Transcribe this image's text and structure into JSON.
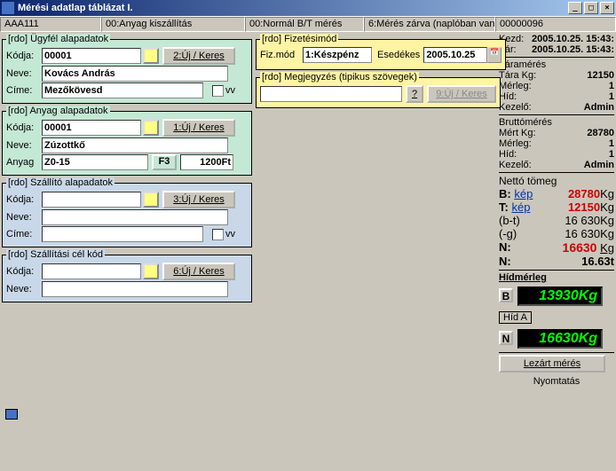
{
  "title": "Mérési adatlap táblázat I.",
  "winbtns": {
    "min": "_",
    "max": "□",
    "close": "×"
  },
  "status": {
    "c1": "AAA111",
    "c2": "00:Anyag kiszállítás",
    "c3": "00:Normál B/T mérés",
    "c4": "6:Mérés zárva (naplóban van)",
    "c5": "00000096"
  },
  "ugyfel": {
    "legend": "[rdo] Ügyfél alapadatok",
    "kodja_lbl": "Kódja:",
    "kodja": "00001",
    "keres": "2:Új / Keres",
    "neve_lbl": "Neve:",
    "neve": "Kovács András",
    "cime_lbl": "Címe:",
    "cime": "Mezőkövesd",
    "vv": "vv"
  },
  "anyag": {
    "legend": "[rdo] Anyag alapadatok",
    "kodja_lbl": "Kódja:",
    "kodja": "00001",
    "keres": "1:Új / Keres",
    "neve_lbl": "Neve:",
    "neve": "Zúzottkő",
    "anyag_lbl": "Anyag",
    "anyag": "Z0-15",
    "f3": "F3",
    "price": "1200Ft"
  },
  "szallito": {
    "legend": "[rdo] Szállító alapadatok",
    "kodja_lbl": "Kódja:",
    "kodja": "",
    "keres": "3:Új / Keres",
    "neve_lbl": "Neve:",
    "neve": "",
    "cime_lbl": "Címe:",
    "cime": "",
    "vv": "vv"
  },
  "cel": {
    "legend": "[rdo] Szállítási cél kód",
    "kodja_lbl": "Kódja:",
    "kodja": "",
    "keres": "6:Új / Keres",
    "neve_lbl": "Neve:",
    "neve": ""
  },
  "fiz": {
    "legend": "[rdo] Fizetésimód",
    "mod_lbl": "Fiz.mód",
    "mod_val": "1:Készpénz",
    "esedekes_lbl": "Esedékes",
    "esedekes_val": "2005.10.25"
  },
  "megj": {
    "legend": "[rdo] Megjegyzés (tipikus szövegek)",
    "q": "?",
    "keres": "9:Új / Keres"
  },
  "right": {
    "kezd_lbl": "Kezd:",
    "kezd_val": "2005.10.25. 15:43:",
    "zar_lbl": "Zár:",
    "zar_val": "2005.10.25. 15:43:",
    "taram": "Táramérés",
    "tarakg_lbl": "Tára Kg:",
    "tarakg_val": "12150",
    "merleg_lbl": "Mérleg:",
    "merleg_val": "1",
    "hid_lbl": "Híd:",
    "hid_val": "1",
    "kezelo_lbl": "Kezelő:",
    "kezelo_val": "Admin",
    "brutto": "Bruttómérés",
    "mertkg_lbl": "Mért Kg:",
    "mertkg_val": "28780",
    "merleg2_lbl": "Mérleg:",
    "merleg2_val": "1",
    "hid2_lbl": "Híd:",
    "hid2_val": "1",
    "kezelo2_lbl": "Kezelő:",
    "kezelo2_val": "Admin",
    "netto": "Nettó tömeg",
    "b_lbl": "B:",
    "b_kep": "kép",
    "b_val": "28780",
    "kg": "Kg",
    "t_lbl": "T:",
    "t_kep": "kép",
    "t_val": "12150",
    "bt_lbl": "(b-t)",
    "bt_val": "16 630Kg",
    "g_lbl": "(-g)",
    "g_val": "16 630Kg",
    "n_lbl": "N:",
    "n_val": "16630",
    "n_kg": "Kg",
    "n2_lbl": "N:",
    "n2_val": "16.63t",
    "hidmerleg": "Hídmérleg",
    "Bbadge": "B",
    "Bval": "13930Kg",
    "hida": "Híd A",
    "Nbadge": "N",
    "Nval": "16630Kg",
    "lezart": "Lezárt mérés",
    "nyomtat": "Nyomtatás"
  }
}
